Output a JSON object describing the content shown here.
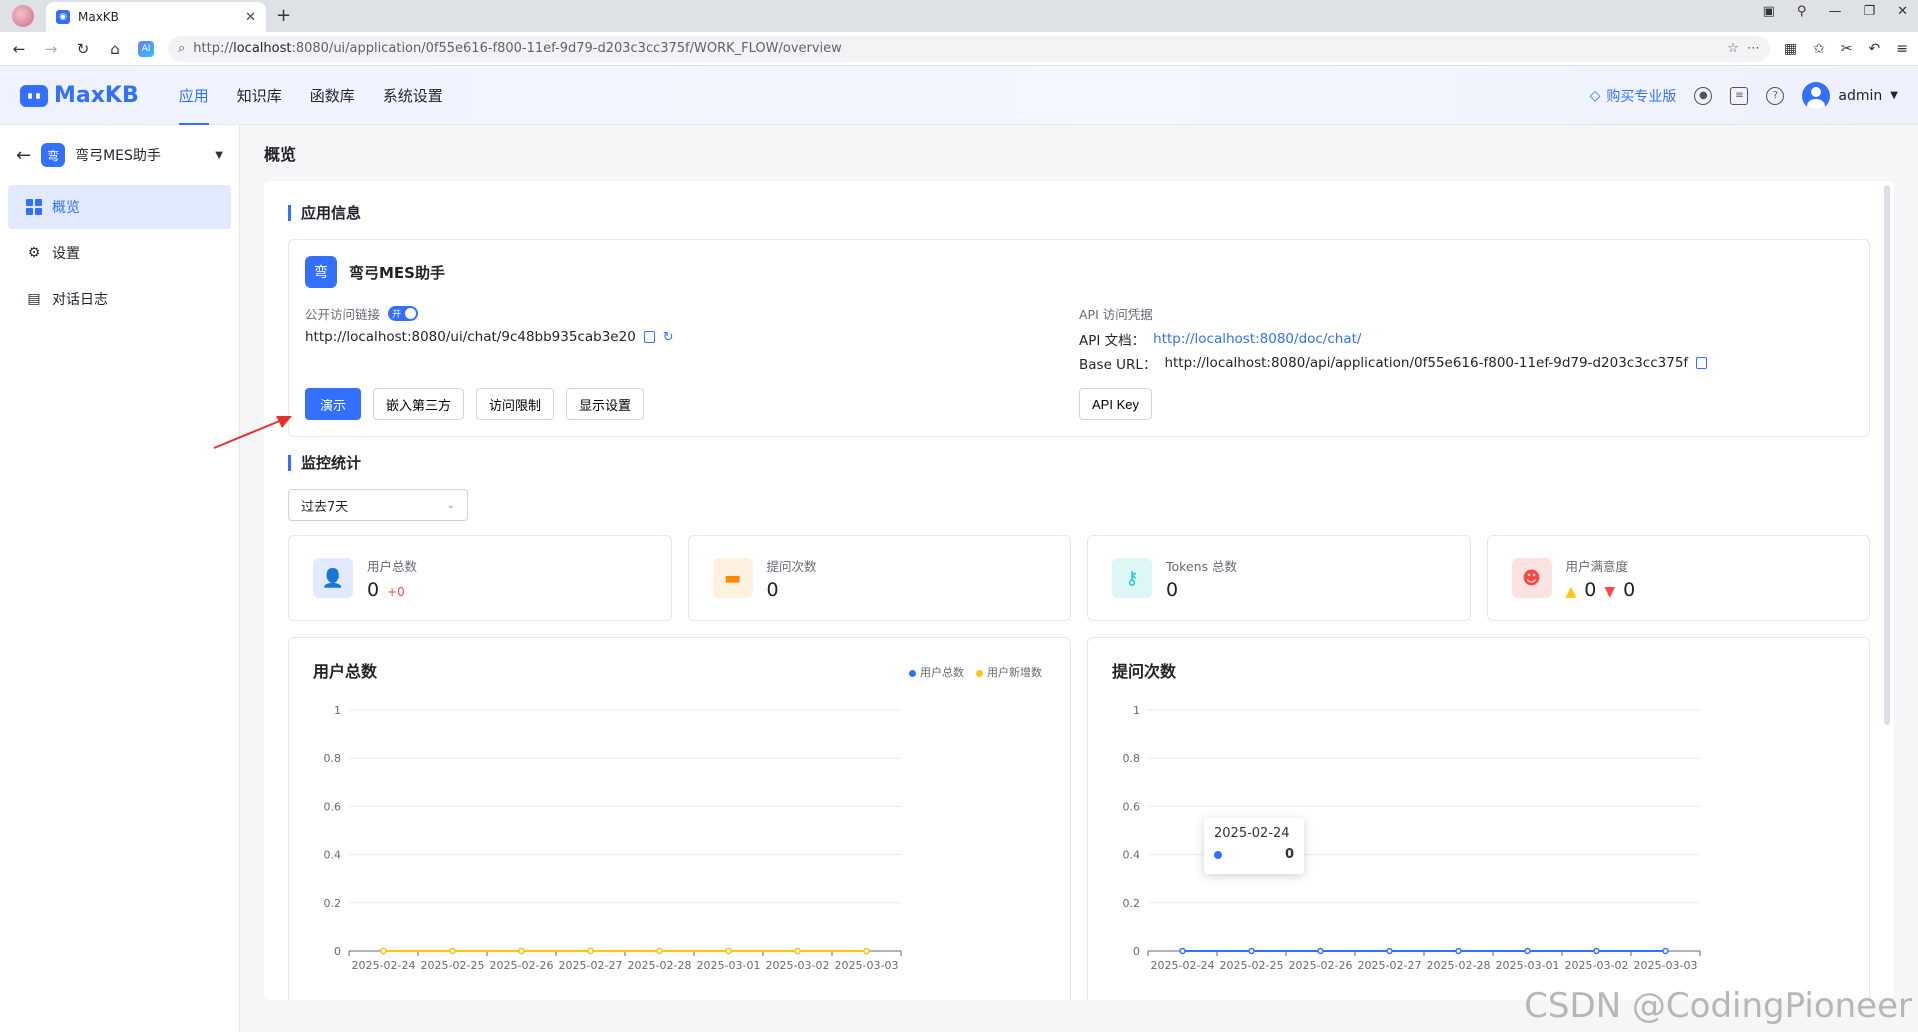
{
  "browser": {
    "tab_title": "MaxKB",
    "url_prefix": "http://",
    "url_host": "localhost",
    "url_rest": ":8080/ui/application/0f55e616-f800-11ef-9d79-d203c3cc375f/WORK_FLOW/overview"
  },
  "header": {
    "logo": "MaxKB",
    "nav": [
      "应用",
      "知识库",
      "函数库",
      "系统设置"
    ],
    "buy_pro": "购买专业版",
    "user": "admin"
  },
  "sidebar": {
    "app_icon_char": "弯",
    "app_name": "弯弓MES助手",
    "items": [
      "概览",
      "设置",
      "对话日志"
    ]
  },
  "page": {
    "title": "概览",
    "app_info_title": "应用信息",
    "app_name": "弯弓MES助手",
    "public_link_label": "公开访问链接",
    "toggle_text": "开",
    "public_link": "http://localhost:8080/ui/chat/9c48bb935cab3e20",
    "api_label": "API 访问凭据",
    "api_doc_label": "API 文档：",
    "api_doc_link": "http://localhost:8080/doc/chat/",
    "base_url_label": "Base URL：",
    "base_url": "http://localhost:8080/api/application/0f55e616-f800-11ef-9d79-d203c3cc375f",
    "buttons": [
      "演示",
      "嵌入第三方",
      "访问限制",
      "显示设置"
    ],
    "api_key_button": "API Key",
    "monitor_title": "监控统计",
    "range_select": "过去7天"
  },
  "stats": [
    {
      "label": "用户总数",
      "value": "0",
      "diff": "+0",
      "color": "#3370ff"
    },
    {
      "label": "提问次数",
      "value": "0",
      "color": "#ff8800"
    },
    {
      "label": "Tokens 总数",
      "value": "0",
      "color": "#14c9c9"
    },
    {
      "label": "用户满意度",
      "up": "0",
      "down": "0",
      "color": "#f54a45"
    }
  ],
  "chart_data": [
    {
      "type": "line",
      "title": "用户总数",
      "categories": [
        "2025-02-24",
        "2025-02-25",
        "2025-02-26",
        "2025-02-27",
        "2025-02-28",
        "2025-03-01",
        "2025-03-02",
        "2025-03-03"
      ],
      "series": [
        {
          "name": "用户总数",
          "values": [
            0,
            0,
            0,
            0,
            0,
            0,
            0,
            0
          ],
          "color": "#3370ff"
        },
        {
          "name": "用户新增数",
          "values": [
            0,
            0,
            0,
            0,
            0,
            0,
            0,
            0
          ],
          "color": "#ffc60a"
        }
      ],
      "yticks": [
        "0",
        "0.2",
        "0.4",
        "0.6",
        "0.8",
        "1"
      ],
      "ylim": [
        0,
        1
      ]
    },
    {
      "type": "line",
      "title": "提问次数",
      "categories": [
        "2025-02-24",
        "2025-02-25",
        "2025-02-26",
        "2025-02-27",
        "2025-02-28",
        "2025-03-01",
        "2025-03-02",
        "2025-03-03"
      ],
      "series": [
        {
          "values": [
            0,
            0,
            0,
            0,
            0,
            0,
            0,
            0
          ],
          "color": "#3370ff"
        }
      ],
      "yticks": [
        "0",
        "0.2",
        "0.4",
        "0.6",
        "0.8",
        "1"
      ],
      "ylim": [
        0,
        1
      ],
      "tooltip": {
        "date": "2025-02-24",
        "value": "0"
      }
    }
  ],
  "watermark": "CSDN @CodingPioneer"
}
